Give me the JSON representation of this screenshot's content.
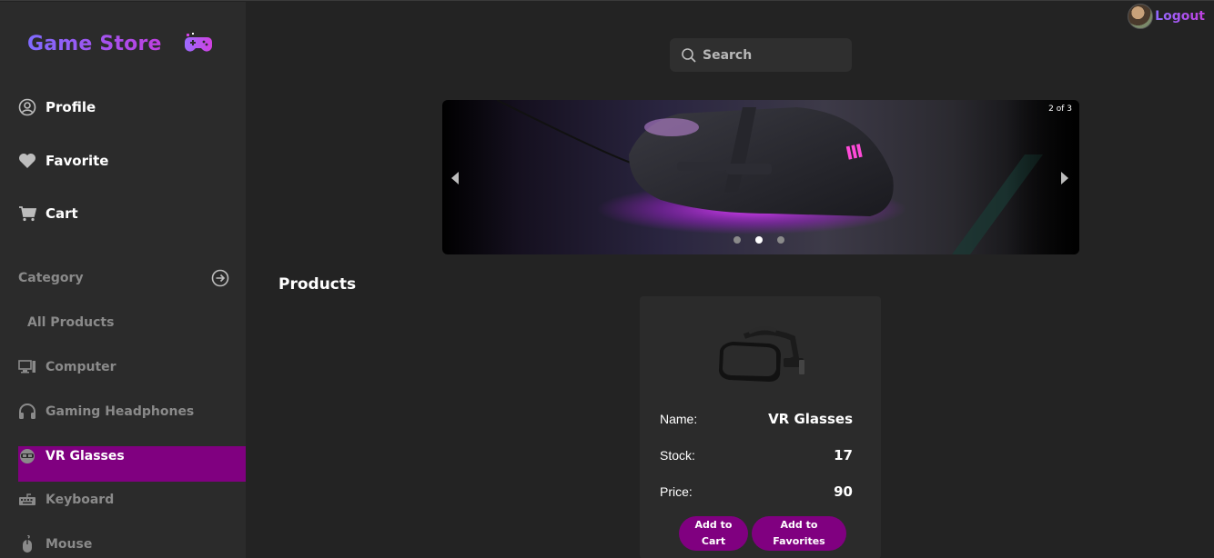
{
  "brand": {
    "title": "Game Store",
    "icon": "gamepad-icon"
  },
  "colors": {
    "accent": "#800080",
    "background": "#232323",
    "sidebar": "#2b2b2b",
    "brand_gradient": [
      "#7f6bff",
      "#c040e0"
    ]
  },
  "nav": {
    "profile": {
      "label": "Profile",
      "icon": "user-circle-icon"
    },
    "favorite": {
      "label": "Favorite",
      "icon": "heart-icon"
    },
    "cart": {
      "label": "Cart",
      "icon": "cart-icon"
    }
  },
  "category": {
    "header": "Category",
    "items": [
      {
        "label": "All Products",
        "icon": ""
      },
      {
        "label": "Computer",
        "icon": "monitor-icon"
      },
      {
        "label": "Gaming Headphones",
        "icon": "headphones-icon"
      },
      {
        "label": "VR Glasses",
        "icon": "vr-headset-icon",
        "active": true
      },
      {
        "label": "Keyboard",
        "icon": "keyboard-icon"
      },
      {
        "label": "Mouse",
        "icon": "mouse-icon"
      }
    ]
  },
  "header": {
    "logout_label": "Logout"
  },
  "search": {
    "placeholder": "Search"
  },
  "carousel": {
    "counter": "2 of 3",
    "current": 2,
    "total": 3
  },
  "products": {
    "title": "Products",
    "items": [
      {
        "name_label": "Name:",
        "name": "VR Glasses",
        "stock_label": "Stock:",
        "stock": "17",
        "price_label": "Price:",
        "price": "90",
        "add_to_cart": "Add to Cart",
        "add_to_favorites": "Add to Favorites"
      }
    ]
  }
}
